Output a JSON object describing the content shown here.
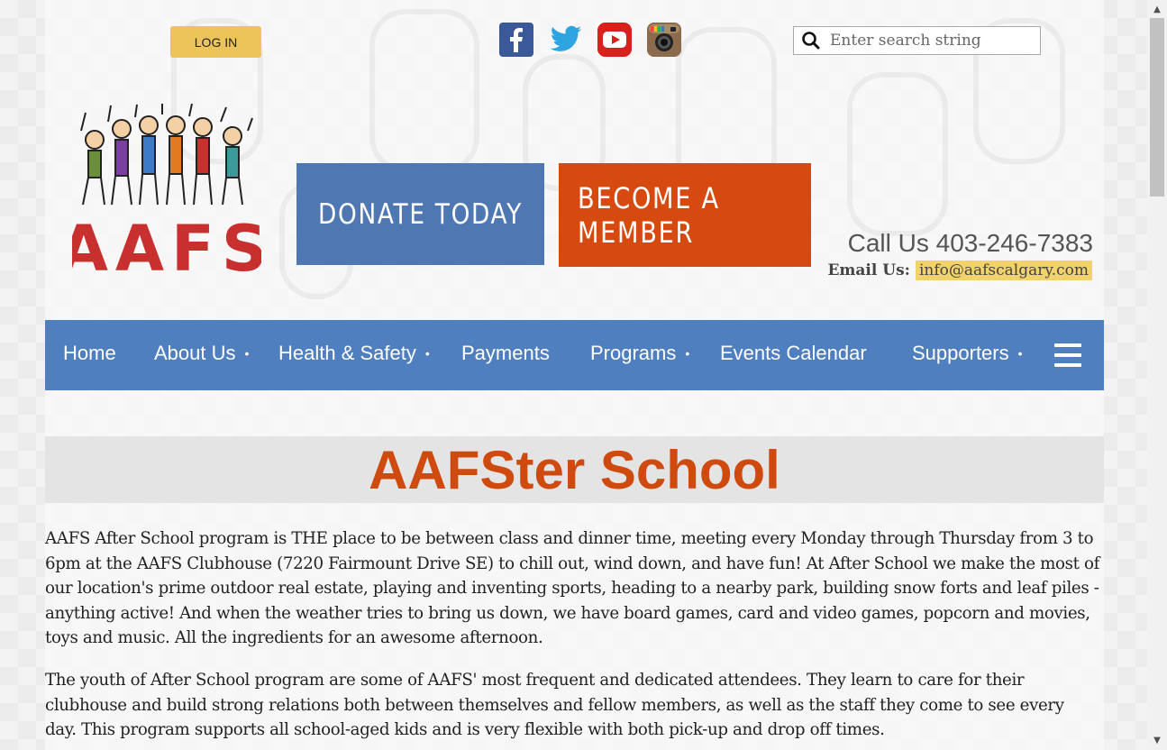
{
  "header": {
    "login_label": "LOG IN",
    "search_placeholder": "Enter search string",
    "social": [
      "facebook-icon",
      "twitter-icon",
      "youtube-icon",
      "instagram-icon"
    ],
    "logo_text": "AAFS",
    "donate_label": "DONATE TODAY",
    "member_label": "BECOME A MEMBER",
    "call_us": "Call Us 403-246-7383",
    "email_label": "Email Us:",
    "email": "info@aafscalgary.com"
  },
  "nav": {
    "items": [
      {
        "label": "Home",
        "dropdown": false
      },
      {
        "label": "About Us",
        "dropdown": true
      },
      {
        "label": "Health & Safety",
        "dropdown": true
      },
      {
        "label": "Payments",
        "dropdown": false
      },
      {
        "label": "Programs",
        "dropdown": true
      },
      {
        "label": "Events Calendar",
        "dropdown": false
      },
      {
        "label": "Supporters",
        "dropdown": true
      }
    ],
    "dropdown_marker": "•"
  },
  "main": {
    "title": "AAFSter School",
    "paragraphs": [
      "AAFS After School program is THE place to be between class and dinner time, meeting every Monday through Thursday from 3 to 6pm at the AAFS Clubhouse (7220 Fairmount Drive SE) to chill out, wind down, and have fun! At After School we make the most of our location's prime outdoor real estate, playing and inventing sports, heading to a nearby park, building snow forts and leaf piles - anything active! And when the weather tries to bring us down, we have board games, card and video games, popcorn and movies, toys and music. All the ingredients for an awesome afternoon.",
      "The youth of After School program are some of AAFS' most frequent and dedicated attendees. They learn to care for their clubhouse and build strong relations both between themselves and fellow members, as well as the staff they come to see every day. This program supports all school-aged kids and is very flexible with both pick-up and drop off times."
    ]
  },
  "colors": {
    "nav_bg": "#4f7fbf",
    "donate_bg": "#4f78b2",
    "member_bg": "#d64a10",
    "title_color": "#cf4a0f",
    "login_bg": "#ecc45a",
    "email_highlight": "#f2d26b"
  }
}
